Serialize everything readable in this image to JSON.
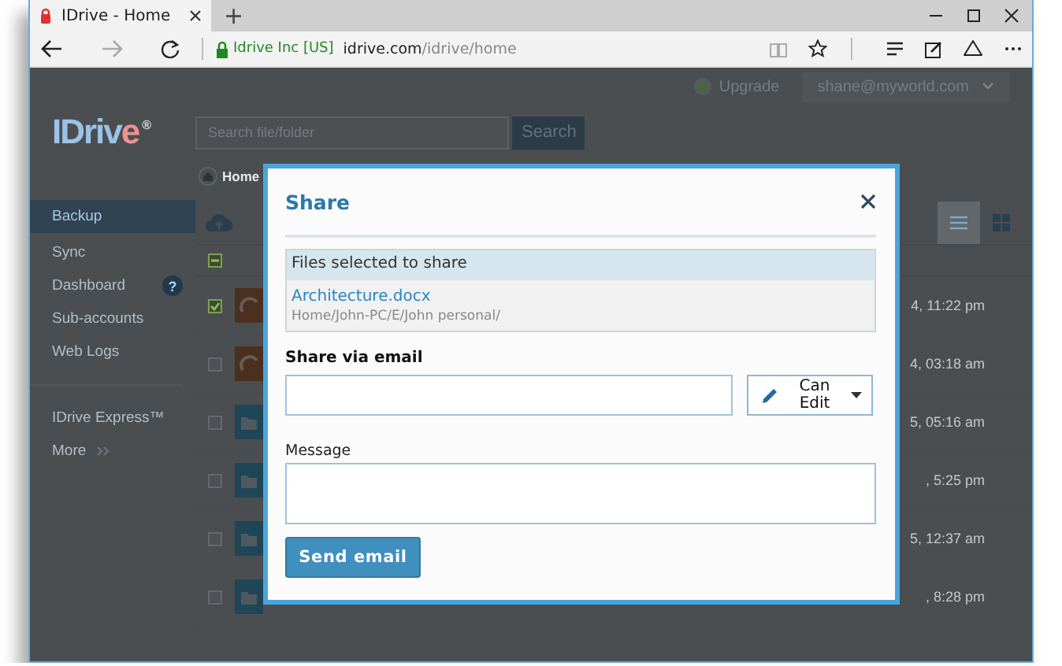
{
  "browser": {
    "tab_title": "IDrive - Home",
    "new_tab": "+",
    "site_identity": "Idrive Inc [US]",
    "url_domain": "idrive.com",
    "url_path": "/idrive/home"
  },
  "header": {
    "upgrade": "Upgrade",
    "account": "shane@myworld.com",
    "logo": {
      "text": "IDriv",
      "accent": "e",
      "mark": "®"
    },
    "search": {
      "placeholder": "Search file/folder"
    },
    "search_button": "Search",
    "breadcrumb": "Home"
  },
  "sidebar": {
    "items": [
      {
        "label": "Backup",
        "selected": true
      },
      {
        "label": "Sync",
        "selected": false
      },
      {
        "label": "Dashboard",
        "selected": false,
        "help": "?"
      },
      {
        "label": "Sub-accounts",
        "selected": false
      },
      {
        "label": "Web Logs",
        "selected": false
      }
    ],
    "extra": [
      {
        "label": "IDrive Express™",
        "kind": "link"
      },
      {
        "label": "More",
        "kind": "more"
      }
    ]
  },
  "files": {
    "view_buttons": [
      {
        "kind": "list",
        "selected": true
      },
      {
        "kind": "grid",
        "selected": false
      }
    ],
    "header_mixed": true,
    "rows": [
      {
        "kind": "image",
        "checked": true,
        "date": "4, 11:22 pm"
      },
      {
        "kind": "image",
        "checked": false,
        "date": "4, 03:18 am"
      },
      {
        "kind": "folder",
        "checked": false,
        "date": "5, 05:16 am"
      },
      {
        "kind": "folder",
        "checked": false,
        "date": ", 5:25 pm"
      },
      {
        "kind": "folder",
        "checked": false,
        "date": "5, 12:37 am"
      },
      {
        "kind": "folder",
        "checked": false,
        "date": ", 8:28 pm"
      }
    ]
  },
  "dialog": {
    "title": "Share",
    "files_header": "Files selected to share",
    "files": [
      {
        "name": "Architecture.docx",
        "path": "Home/John-PC/E/John personal/"
      }
    ],
    "share_label": "Share via email",
    "permission": "Can Edit",
    "message_label": "Message",
    "send_button": "Send email"
  }
}
